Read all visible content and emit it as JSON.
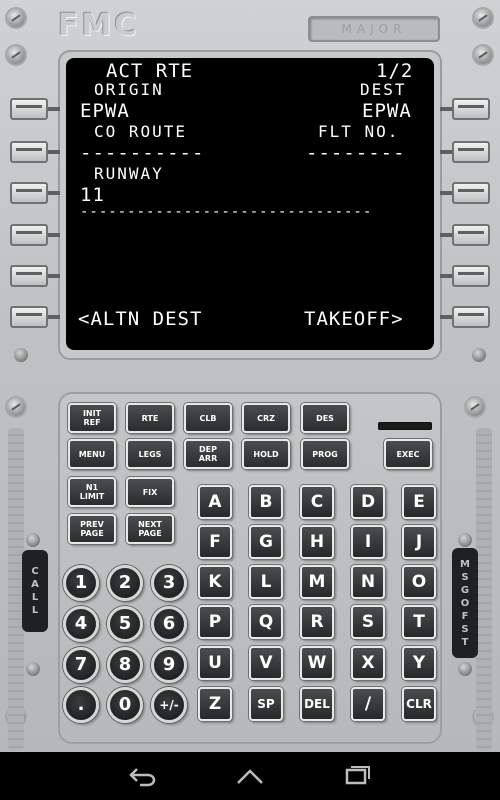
{
  "header": {
    "logo": "FMC",
    "badge": "MAJOR"
  },
  "screen": {
    "title": "ACT RTE",
    "page": "1/2",
    "rows": {
      "origin_label": "ORIGIN",
      "dest_label": "DEST",
      "origin_value": "EPWA",
      "dest_value": "EPWA",
      "co_route_label": "CO ROUTE",
      "flt_no_label": "FLT NO.",
      "co_route_value": "----------",
      "flt_no_value": "--------",
      "runway_label": "RUNWAY",
      "runway_value": "11",
      "separator": "-------------------------------",
      "left_action": "<ALTN DEST",
      "right_action": "TAKEOFF>"
    }
  },
  "function_keys": {
    "init_ref": "INIT\nREF",
    "rte": "RTE",
    "clb": "CLB",
    "crz": "CRZ",
    "des": "DES",
    "menu": "MENU",
    "legs": "LEGS",
    "dep_arr": "DEP\nARR",
    "hold": "HOLD",
    "prog": "PROG",
    "exec": "EXEC",
    "n1_limit": "N1\nLIMIT",
    "fix": "FIX",
    "prev_page": "PREV\nPAGE",
    "next_page": "NEXT\nPAGE"
  },
  "alpha_keys": [
    "A",
    "B",
    "C",
    "D",
    "E",
    "F",
    "G",
    "H",
    "I",
    "J",
    "K",
    "L",
    "M",
    "N",
    "O",
    "P",
    "Q",
    "R",
    "S",
    "T",
    "U",
    "V",
    "W",
    "X",
    "Y",
    "Z",
    "SP",
    "DEL",
    "/",
    "CLR"
  ],
  "numeric_keys": [
    "1",
    "2",
    "3",
    "4",
    "5",
    "6",
    "7",
    "8",
    "9",
    ".",
    "0",
    "+/-"
  ],
  "side_labels": {
    "call": [
      "C",
      "A",
      "L",
      "L"
    ],
    "msg_ofst": [
      "M",
      "S",
      "G",
      "O",
      "F",
      "S",
      "T"
    ]
  },
  "colors": {
    "panel": "#bfc2c3",
    "screen_bg": "#000000",
    "screen_text": "#ffffff",
    "key_bg": "#2f3133"
  },
  "icons": {
    "nav_back": "back-arrow-icon",
    "nav_home": "home-icon",
    "nav_recent": "recent-apps-icon"
  }
}
